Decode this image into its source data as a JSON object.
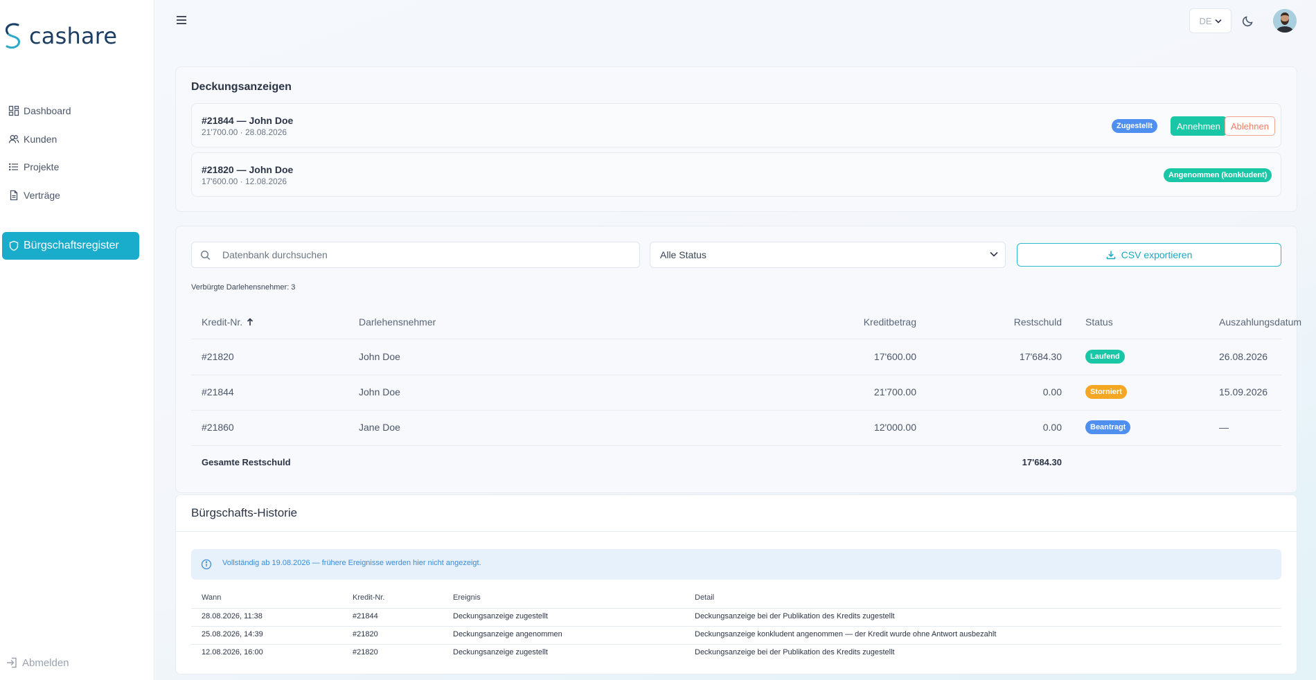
{
  "brand": {
    "name": "cashare"
  },
  "sidebar": {
    "items": [
      {
        "label": "Dashboard",
        "icon": "dashboard-icon"
      },
      {
        "label": "Kunden",
        "icon": "users-icon"
      },
      {
        "label": "Projekte",
        "icon": "list-icon"
      },
      {
        "label": "Verträge",
        "icon": "document-icon"
      },
      {
        "label": "Bürgschaftsregister",
        "icon": "shield-icon",
        "active": true
      }
    ],
    "logout": "Abmelden"
  },
  "topbar": {
    "language": "DE"
  },
  "notices": {
    "title": "Deckungsanzeigen",
    "items": [
      {
        "title": "#21844 — John Doe",
        "sub": "21'700.00 · 28.08.2026",
        "badge": "Zugestellt",
        "accept": "Annehmen",
        "reject": "Ablehnen"
      },
      {
        "title": "#21820 — John Doe",
        "sub": "17'600.00 · 12.08.2026",
        "badge": "Angenommen (konkludent)"
      }
    ]
  },
  "register": {
    "search_placeholder": "Datenbank durchsuchen",
    "status_select": "Alle Status",
    "csv_label": "CSV exportieren",
    "count_label": "Verbürgte Darlehensnehmer: 3",
    "columns": [
      "Kredit-Nr.",
      "Darlehensnehmer",
      "Kreditbetrag",
      "Restschuld",
      "Status",
      "Auszahlungsdatum"
    ],
    "rows": [
      {
        "id": "#21820",
        "name": "John Doe",
        "amount": "17'600.00",
        "rest": "17'684.30",
        "status": "Laufend",
        "date": "26.08.2026"
      },
      {
        "id": "#21844",
        "name": "John Doe",
        "amount": "21'700.00",
        "rest": "0.00",
        "status": "Storniert",
        "date": "15.09.2026"
      },
      {
        "id": "#21860",
        "name": "Jane Doe",
        "amount": "12'000.00",
        "rest": "0.00",
        "status": "Beantragt",
        "date": "—"
      }
    ],
    "total_label": "Gesamte Restschuld",
    "total_value": "17'684.30"
  },
  "history": {
    "title": "Bürgschafts-Historie",
    "info": "Vollständig ab 19.08.2026 — frühere Ereignisse werden hier nicht angezeigt.",
    "columns": [
      "Wann",
      "Kredit-Nr.",
      "Ereignis",
      "Detail"
    ],
    "rows": [
      {
        "when": "28.08.2026, 11:38",
        "id": "#21844",
        "event": "Deckungsanzeige zugestellt",
        "detail": "Deckungsanzeige bei der Publikation des Kredits zugestellt"
      },
      {
        "when": "25.08.2026, 14:39",
        "id": "#21820",
        "event": "Deckungsanzeige angenommen",
        "detail": "Deckungsanzeige konkludent angenommen — der Kredit wurde ohne Antwort ausbezahlt"
      },
      {
        "when": "12.08.2026, 16:00",
        "id": "#21820",
        "event": "Deckungsanzeige zugestellt",
        "detail": "Deckungsanzeige bei der Publikation des Kredits zugestellt"
      }
    ]
  },
  "colors": {
    "accent": "#1aaccb",
    "badge_blue": "#4f8ff0",
    "badge_green": "#19c7a6",
    "badge_orange": "#f5a623",
    "reject": "#ef7a63"
  }
}
